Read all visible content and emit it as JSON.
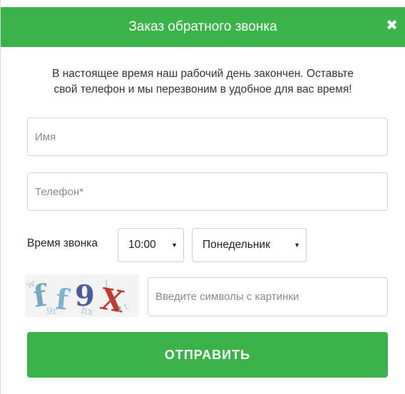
{
  "header": {
    "title": "Заказ обратного звонка",
    "close_label": "✖"
  },
  "message": {
    "line1": "В настоящее время наш рабочий день закончен. Оставьте",
    "line2": "свой телефон и мы перезвоним в удобное для вас время!"
  },
  "form": {
    "name_placeholder": "Имя",
    "phone_placeholder": "Телефон*",
    "time_label": "Время звонка",
    "time_value": "10:00",
    "day_value": "Понедельник",
    "captcha_text": "ff9X",
    "captcha_placeholder": "Введите символы с картинки",
    "submit_label": "ОТПРАВИТЬ"
  },
  "colors": {
    "accent": "#3bb34a"
  }
}
